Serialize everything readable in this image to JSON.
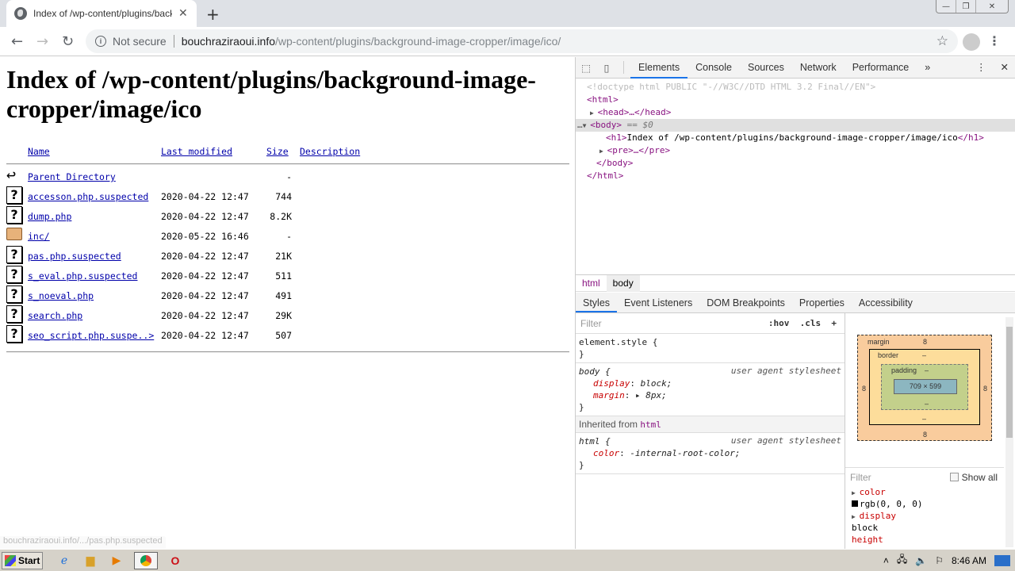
{
  "browser": {
    "tab_title": "Index of /wp-content/plugins/background-image-cropper/image/ico/",
    "new_tab_label": "+",
    "window_controls": {
      "minimize": "—",
      "restore": "❐",
      "close": "✕"
    },
    "security_label": "Not secure",
    "url_host": "bouchraziraoui.info",
    "url_path": "/wp-content/plugins/background-image-cropper/image/ico/",
    "status_url": "bouchraziraoui.info/.../pas.php.suspected"
  },
  "page": {
    "heading": "Index of /wp-content/plugins/background-image-cropper/image/ico",
    "columns": {
      "name": "Name",
      "modified": "Last modified",
      "size": "Size",
      "description": "Description"
    },
    "entries": [
      {
        "icon": "back",
        "name": "Parent Directory",
        "modified": "",
        "size": "-"
      },
      {
        "icon": "unknown",
        "name": "accesson.php.suspected",
        "modified": "2020-04-22 12:47",
        "size": "744"
      },
      {
        "icon": "unknown",
        "name": "dump.php",
        "modified": "2020-04-22 12:47",
        "size": "8.2K"
      },
      {
        "icon": "folder",
        "name": "inc/",
        "modified": "2020-05-22 16:46",
        "size": "-"
      },
      {
        "icon": "unknown",
        "name": "pas.php.suspected",
        "modified": "2020-04-22 12:47",
        "size": "21K"
      },
      {
        "icon": "unknown",
        "name": "s_eval.php.suspected",
        "modified": "2020-04-22 12:47",
        "size": "511"
      },
      {
        "icon": "unknown",
        "name": "s_noeval.php",
        "modified": "2020-04-22 12:47",
        "size": "491"
      },
      {
        "icon": "unknown",
        "name": "search.php",
        "modified": "2020-04-22 12:47",
        "size": "29K"
      },
      {
        "icon": "unknown",
        "name": "seo_script.php.suspe..>",
        "modified": "2020-04-22 12:47",
        "size": "507"
      }
    ]
  },
  "devtools": {
    "tabs": [
      "Elements",
      "Console",
      "Sources",
      "Network",
      "Performance"
    ],
    "more_tabs": "»",
    "dom": {
      "doctype": "<!doctype html PUBLIC \"-//W3C//DTD HTML 3.2 Final//EN\">",
      "html_open": "<html>",
      "head": "<head>…</head>",
      "body_open": "<body>",
      "body_marker": "== $0",
      "h1_text": "Index of /wp-content/plugins/background-image-cropper/image/ico",
      "pre": "<pre>…</pre>",
      "body_close": "</body>",
      "html_close": "</html>"
    },
    "breadcrumbs": [
      "html",
      "body"
    ],
    "subtabs": [
      "Styles",
      "Event Listeners",
      "DOM Breakpoints",
      "Properties",
      "Accessibility"
    ],
    "styles": {
      "filter_placeholder": "Filter",
      "hov": ":hov",
      "cls": ".cls",
      "add": "+",
      "element_style": "element.style {",
      "close_brace": "}",
      "body_selector": "body {",
      "ua_label": "user agent stylesheet",
      "body_props": [
        {
          "name": "display",
          "value": "block;"
        },
        {
          "name": "margin",
          "value": "▸ 8px;"
        }
      ],
      "inherited_label": "Inherited from",
      "inherited_from": "html",
      "html_selector": "html {",
      "html_props": [
        {
          "name": "color",
          "value": "-internal-root-color;"
        }
      ]
    },
    "box_model": {
      "margin_label": "margin",
      "margin": "8",
      "margin_bottom": "8",
      "margin_left": "8",
      "margin_right": "8",
      "border_label": "border",
      "border": "–",
      "padding_label": "padding",
      "padding": "–",
      "content": "709 × 599"
    },
    "computed": {
      "filter_placeholder": "Filter",
      "show_all": "Show all",
      "props": [
        {
          "name": "color",
          "value": "rgb(0, 0, 0)"
        },
        {
          "name": "display",
          "value": "block"
        },
        {
          "name": "height",
          "value": ""
        }
      ]
    }
  },
  "taskbar": {
    "start_label": "Start",
    "clock": "8:46 AM"
  }
}
